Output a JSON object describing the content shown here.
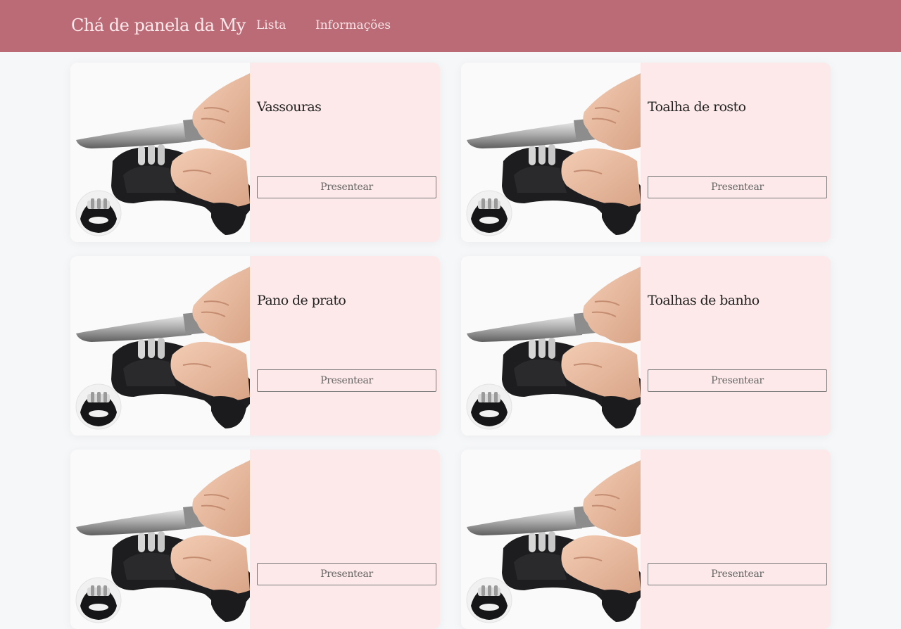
{
  "header": {
    "brand": "Chá de panela da My",
    "nav": [
      {
        "label": "Lista"
      },
      {
        "label": "Informações"
      }
    ]
  },
  "colors": {
    "navbar": "#bb6b76",
    "card_background": "#fde9e9",
    "page_background": "#f6f7f9"
  },
  "gifts": [
    {
      "name": "Vassouras",
      "button": "Presentear",
      "image": "knife-sharpener-image"
    },
    {
      "name": "Toalha de rosto",
      "button": "Presentear",
      "image": "knife-sharpener-image"
    },
    {
      "name": "Pano de prato",
      "button": "Presentear",
      "image": "knife-sharpener-image"
    },
    {
      "name": "Toalhas de banho",
      "button": "Presentear",
      "image": "knife-sharpener-image"
    },
    {
      "name": "",
      "button": "Presentear",
      "image": "knife-sharpener-image"
    },
    {
      "name": "",
      "button": "Presentear",
      "image": "knife-sharpener-image"
    }
  ]
}
